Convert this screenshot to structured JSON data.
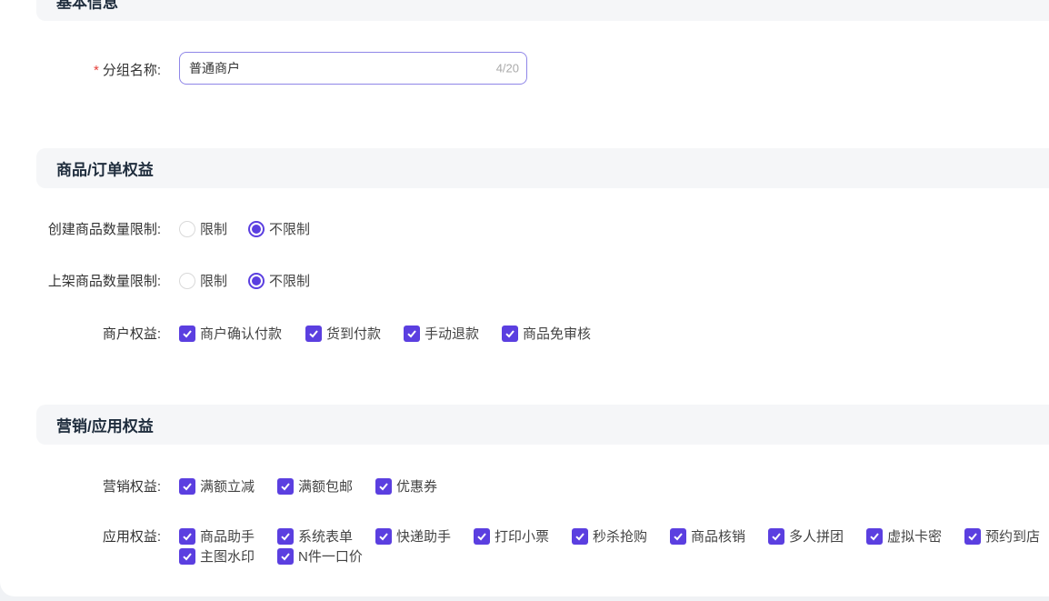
{
  "sections": {
    "basic": "基本信息",
    "goods": "商品/订单权益",
    "marketing": "营销/应用权益"
  },
  "group_name": {
    "required_mark": "*",
    "label": "分组名称:",
    "value": "普通商户",
    "count": "4/20"
  },
  "create_limit": {
    "label": "创建商品数量限制:",
    "opt1": "限制",
    "opt2": "不限制",
    "selected": "不限制"
  },
  "shelf_limit": {
    "label": "上架商品数量限制:",
    "opt1": "限制",
    "opt2": "不限制",
    "selected": "不限制"
  },
  "merchant_rights": {
    "label": "商户权益:",
    "items": [
      "商户确认付款",
      "货到付款",
      "手动退款",
      "商品免审核"
    ]
  },
  "marketing_rights": {
    "label": "营销权益:",
    "items": [
      "满额立减",
      "满额包邮",
      "优惠券"
    ]
  },
  "app_rights": {
    "label": "应用权益:",
    "items": [
      "商品助手",
      "系统表单",
      "快递助手",
      "打印小票",
      "秒杀抢购",
      "商品核销",
      "多人拼团",
      "虚拟卡密",
      "预约到店",
      "主图水印",
      "N件一口价"
    ]
  },
  "colors": {
    "accent": "#5b3fe0",
    "required": "#e5403a"
  }
}
